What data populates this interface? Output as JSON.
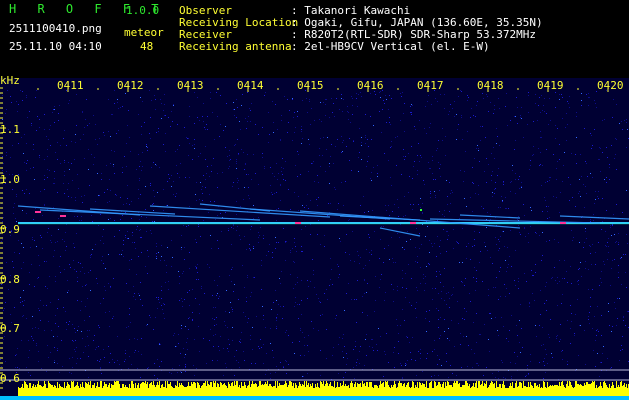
{
  "header": {
    "app_title": "H R O F F T",
    "version": "1.0.0",
    "filename": "2511100410.png",
    "datetime": "25.11.10 04:10",
    "meteor_label": "meteor",
    "meteor_count": "48",
    "info": [
      {
        "label": "Observer",
        "value": ": Takanori Kawachi"
      },
      {
        "label": "Receiving Location",
        "value": ": Ogaki, Gifu, JAPAN (136.60E, 35.35N)"
      },
      {
        "label": "Receiver",
        "value": ": R820T2(RTL-SDR) SDR-Sharp 53.372MHz"
      },
      {
        "label": "Receiving antenna",
        "value": ": 2el-HB9CV Vertical (el. E-W)"
      }
    ]
  },
  "spectrogram": {
    "unit_label": "kHz",
    "y_ticks": [
      "1.1",
      "1.0",
      "0.9",
      "0.8",
      "0.7",
      "0.6"
    ],
    "time_ticks": [
      "0411",
      "0412",
      "0413",
      "0414",
      "0415",
      "0416",
      "0417",
      "0418",
      "0419",
      "0420"
    ],
    "colors": {
      "background": "#000033",
      "noise": "#1a1acc",
      "carrier": "#33ccff",
      "axis": "#ffff33",
      "activity_bar": "#ffff00",
      "baseline": "#00bfff"
    }
  }
}
